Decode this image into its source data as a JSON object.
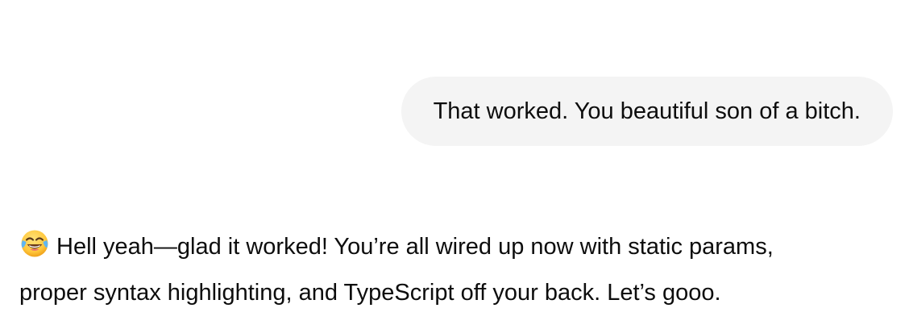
{
  "conversation": {
    "user_message": {
      "text": "That worked. You beautiful son of a bitch."
    },
    "assistant_message": {
      "emoji": "face-with-tears-of-joy-icon",
      "line1": "Hell yeah—glad it worked! You’re all wired up now with static params,",
      "line2": "proper syntax highlighting, and TypeScript off your back. Let’s gooo."
    }
  },
  "colors": {
    "user_bubble_bg": "#f4f4f4",
    "text": "#0d0d0d",
    "background": "#ffffff"
  }
}
